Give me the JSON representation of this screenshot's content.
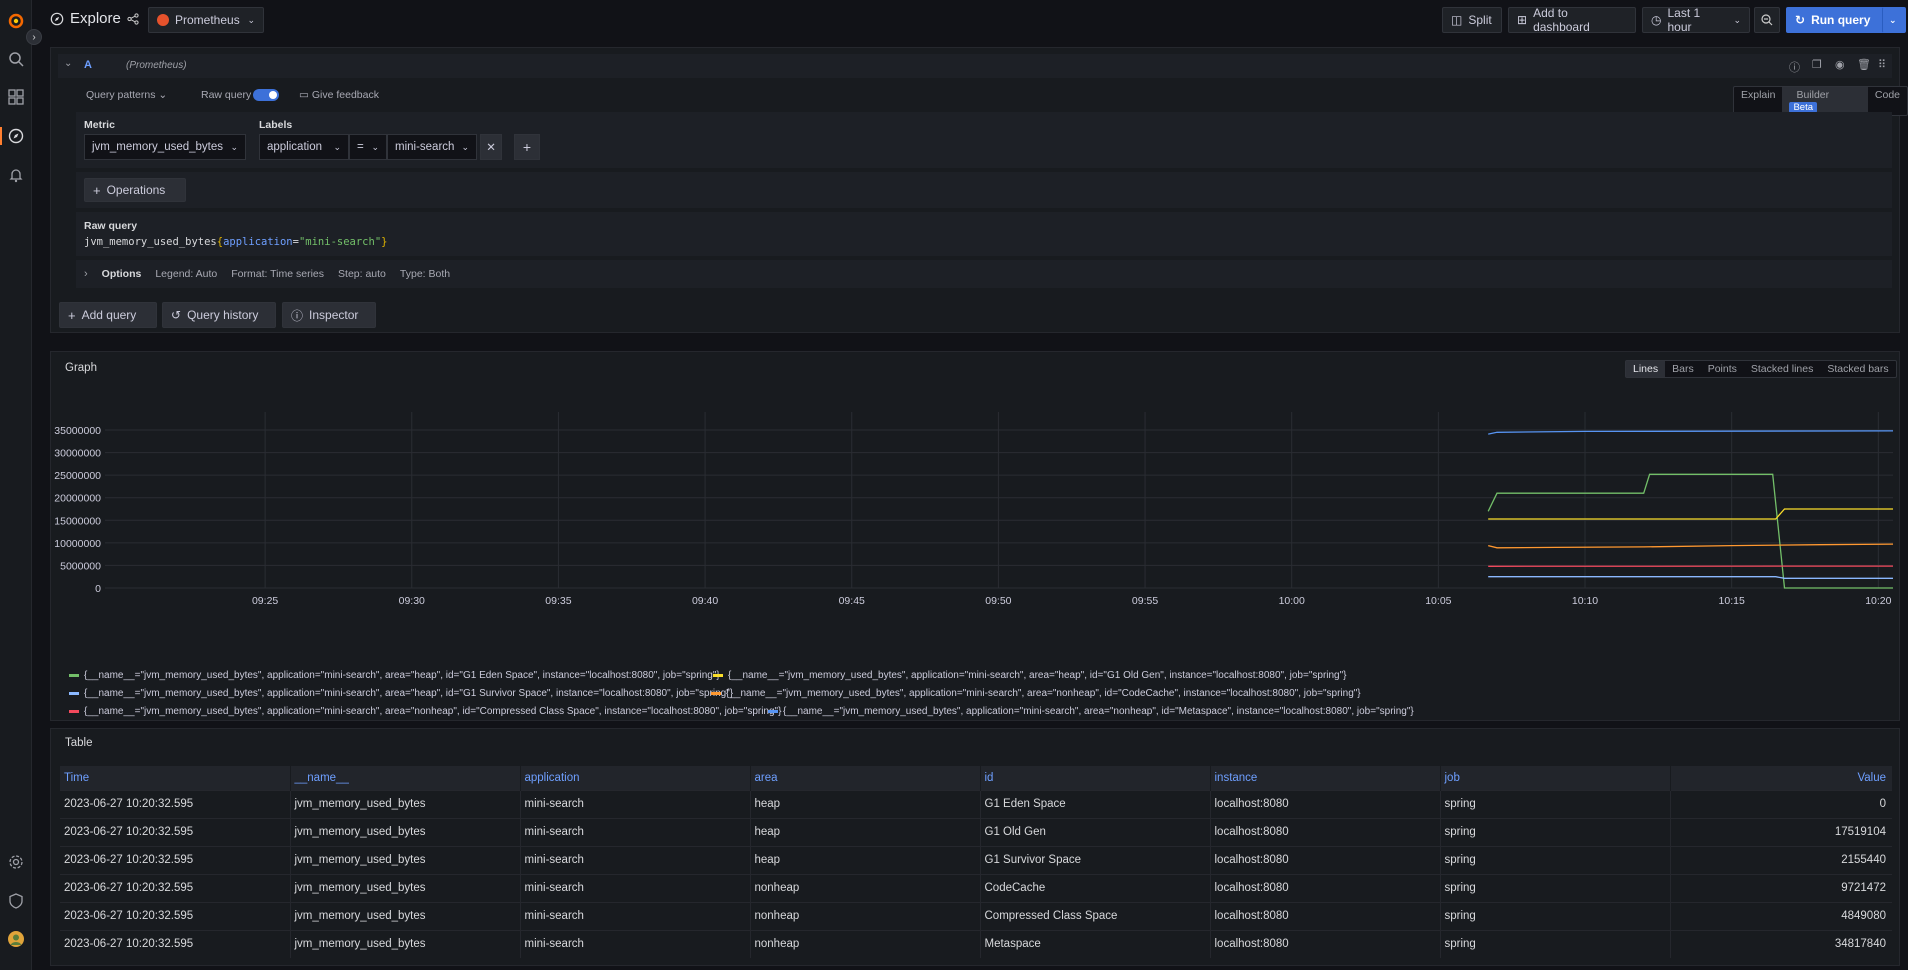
{
  "app": {
    "title": "Explore",
    "datasource": "Prometheus"
  },
  "toolbar": {
    "split": "Split",
    "add_to_dashboard": "Add to dashboard",
    "time_range": "Last 1 hour",
    "run_query": "Run query"
  },
  "query": {
    "ref_id": "A",
    "ds_hint": "(Prometheus)",
    "patterns_label": "Query patterns",
    "raw_query_label": "Raw query",
    "feedback_label": "Give feedback",
    "modes": [
      "Explain",
      "Builder",
      "Code"
    ],
    "beta_badge": "Beta",
    "metric_label": "Metric",
    "metric_value": "jvm_memory_used_bytes",
    "labels_label": "Labels",
    "label_key": "application",
    "label_op": "=",
    "label_value": "mini-search",
    "operations_label": "Operations",
    "raw_query_title": "Raw query",
    "raw_metric": "jvm_memory_used_bytes",
    "raw_open": "{",
    "raw_key": "application",
    "raw_eq": "=",
    "raw_val": "\"mini-search\"",
    "raw_close": "}",
    "options_label": "Options",
    "options": [
      "Legend: Auto",
      "Format: Time series",
      "Step: auto",
      "Type: Both"
    ]
  },
  "actions": {
    "add_query": "Add query",
    "query_history": "Query history",
    "inspector": "Inspector"
  },
  "graph": {
    "title": "Graph",
    "view_modes": [
      "Lines",
      "Bars",
      "Points",
      "Stacked lines",
      "Stacked bars"
    ],
    "active_mode": "Lines"
  },
  "colors": {
    "green": "#73bf69",
    "yellow": "#fade2a",
    "lightblue": "#8ab8ff",
    "orange": "#ff9830",
    "red": "#f2495c",
    "blue": "#5794f2",
    "accent": "#3d71d9"
  },
  "chart_data": {
    "type": "line",
    "y_tick_labels": [
      "35000000",
      "30000000",
      "25000000",
      "20000000",
      "15000000",
      "10000000",
      "5000000",
      "0"
    ],
    "x_tick_labels": [
      "09:25",
      "09:30",
      "09:35",
      "09:40",
      "09:45",
      "09:50",
      "09:55",
      "10:00",
      "10:05",
      "10:10",
      "10:15",
      "10:20"
    ],
    "x_unit": "minutes since 09:25",
    "xlim": [
      -7.3,
      55.5
    ],
    "ylim": [
      0,
      39000000
    ],
    "grid": true,
    "legend_placement": "bottom",
    "series": [
      {
        "name": "{__name__=\"jvm_memory_used_bytes\", application=\"mini-search\", area=\"heap\", id=\"G1 Eden Space\", instance=\"localhost:8080\", job=\"spring\"}",
        "color": "#73bf69",
        "points": [
          [
            41.7,
            17000000
          ],
          [
            42.0,
            21000000
          ],
          [
            43.5,
            21000000
          ],
          [
            47.0,
            21000000
          ],
          [
            47.2,
            25200000
          ],
          [
            50.0,
            25200000
          ],
          [
            51.4,
            25200000
          ],
          [
            51.8,
            0
          ],
          [
            55.5,
            0
          ]
        ]
      },
      {
        "name": "{__name__=\"jvm_memory_used_bytes\", application=\"mini-search\", area=\"heap\", id=\"G1 Old Gen\", instance=\"localhost:8080\", job=\"spring\"}",
        "color": "#fade2a",
        "points": [
          [
            41.7,
            15300000
          ],
          [
            45.0,
            15300000
          ],
          [
            51.5,
            15300000
          ],
          [
            51.8,
            17500000
          ],
          [
            55.5,
            17500000
          ]
        ]
      },
      {
        "name": "{__name__=\"jvm_memory_used_bytes\", application=\"mini-search\", area=\"heap\", id=\"G1 Survivor Space\", instance=\"localhost:8080\", job=\"spring\"}",
        "color": "#8ab8ff",
        "points": [
          [
            41.7,
            2500000
          ],
          [
            51.5,
            2500000
          ],
          [
            51.8,
            2155440
          ],
          [
            55.5,
            2155440
          ]
        ]
      },
      {
        "name": "{__name__=\"jvm_memory_used_bytes\", application=\"mini-search\", area=\"nonheap\", id=\"CodeCache\", instance=\"localhost:8080\", job=\"spring\"}",
        "color": "#ff9830",
        "points": [
          [
            41.7,
            9400000
          ],
          [
            42.0,
            8900000
          ],
          [
            44.0,
            9000000
          ],
          [
            47.0,
            9100000
          ],
          [
            50.0,
            9400000
          ],
          [
            53.0,
            9600000
          ],
          [
            55.5,
            9721472
          ]
        ]
      },
      {
        "name": "{__name__=\"jvm_memory_used_bytes\", application=\"mini-search\", area=\"nonheap\", id=\"Compressed Class Space\", instance=\"localhost:8080\", job=\"spring\"}",
        "color": "#f2495c",
        "points": [
          [
            41.7,
            4800000
          ],
          [
            55.5,
            4849080
          ]
        ]
      },
      {
        "name": "{__name__=\"jvm_memory_used_bytes\", application=\"mini-search\", area=\"nonheap\", id=\"Metaspace\", instance=\"localhost:8080\", job=\"spring\"}",
        "color": "#5794f2",
        "points": [
          [
            41.7,
            34100000
          ],
          [
            42.0,
            34500000
          ],
          [
            45.0,
            34700000
          ],
          [
            55.5,
            34817840
          ]
        ]
      }
    ]
  },
  "table": {
    "title": "Table",
    "headers": [
      "Time",
      "__name__",
      "application",
      "area",
      "id",
      "instance",
      "job",
      "Value"
    ],
    "rows": [
      [
        "2023-06-27 10:20:32.595",
        "jvm_memory_used_bytes",
        "mini-search",
        "heap",
        "G1 Eden Space",
        "localhost:8080",
        "spring",
        "0"
      ],
      [
        "2023-06-27 10:20:32.595",
        "jvm_memory_used_bytes",
        "mini-search",
        "heap",
        "G1 Old Gen",
        "localhost:8080",
        "spring",
        "17519104"
      ],
      [
        "2023-06-27 10:20:32.595",
        "jvm_memory_used_bytes",
        "mini-search",
        "heap",
        "G1 Survivor Space",
        "localhost:8080",
        "spring",
        "2155440"
      ],
      [
        "2023-06-27 10:20:32.595",
        "jvm_memory_used_bytes",
        "mini-search",
        "nonheap",
        "CodeCache",
        "localhost:8080",
        "spring",
        "9721472"
      ],
      [
        "2023-06-27 10:20:32.595",
        "jvm_memory_used_bytes",
        "mini-search",
        "nonheap",
        "Compressed Class Space",
        "localhost:8080",
        "spring",
        "4849080"
      ],
      [
        "2023-06-27 10:20:32.595",
        "jvm_memory_used_bytes",
        "mini-search",
        "nonheap",
        "Metaspace",
        "localhost:8080",
        "spring",
        "34817840"
      ]
    ]
  }
}
